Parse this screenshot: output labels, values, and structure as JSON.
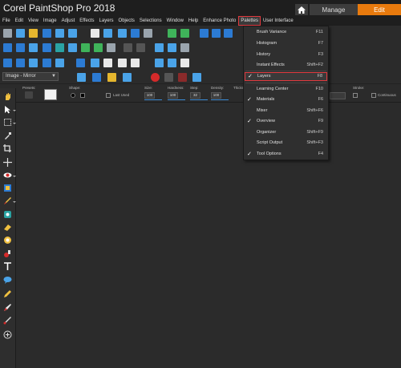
{
  "app": {
    "title": "Corel PaintShop Pro 2018",
    "tabs": {
      "manage": "Manage",
      "edit": "Edit"
    }
  },
  "menubar": {
    "items": [
      "File",
      "Edit",
      "View",
      "Image",
      "Adjust",
      "Effects",
      "Layers",
      "Objects",
      "Selections",
      "Window",
      "Help",
      "Enhance Photo",
      "Palettes",
      "User Interface"
    ]
  },
  "toolbar": {
    "script_dropdown": "Image - Mirror"
  },
  "tool_options": {
    "presets_label": "Presets:",
    "shape_label": "Shape:",
    "last_used_label": "Last Used",
    "size_label": "Size:",
    "size_value": "100",
    "hardness_label": "Hardness:",
    "hardness_value": "100",
    "step_label": "Step:",
    "step_value": "32",
    "density_label": "Density:",
    "density_value": "100",
    "thickness_label": "Thickn",
    "stroke_label": "Stroke:",
    "continuous_label": "Continuous"
  },
  "palettes_menu": {
    "items": [
      {
        "label": "Brush Variance",
        "shortcut": "F11",
        "checked": false
      },
      {
        "label": "Histogram",
        "shortcut": "F7",
        "checked": false
      },
      {
        "label": "History",
        "shortcut": "F3",
        "checked": false
      },
      {
        "label": "Instant Effects",
        "shortcut": "Shift+F2",
        "checked": false
      },
      {
        "label": "Layers",
        "shortcut": "F8",
        "checked": true
      },
      {
        "label": "Learning Center",
        "shortcut": "F10",
        "checked": false
      },
      {
        "label": "Materials",
        "shortcut": "F6",
        "checked": true
      },
      {
        "label": "Mixer",
        "shortcut": "Shift+F6",
        "checked": false
      },
      {
        "label": "Overview",
        "shortcut": "F9",
        "checked": true
      },
      {
        "label": "Organizer",
        "shortcut": "Shift+F9",
        "checked": false
      },
      {
        "label": "Script Output",
        "shortcut": "Shift+F3",
        "checked": false
      },
      {
        "label": "Tool Options",
        "shortcut": "F4",
        "checked": true
      }
    ],
    "check_glyph": "✓"
  },
  "colors": {
    "accent": "#e87a0d",
    "highlight_border": "#e0393e",
    "background": "#2b2b2b"
  }
}
